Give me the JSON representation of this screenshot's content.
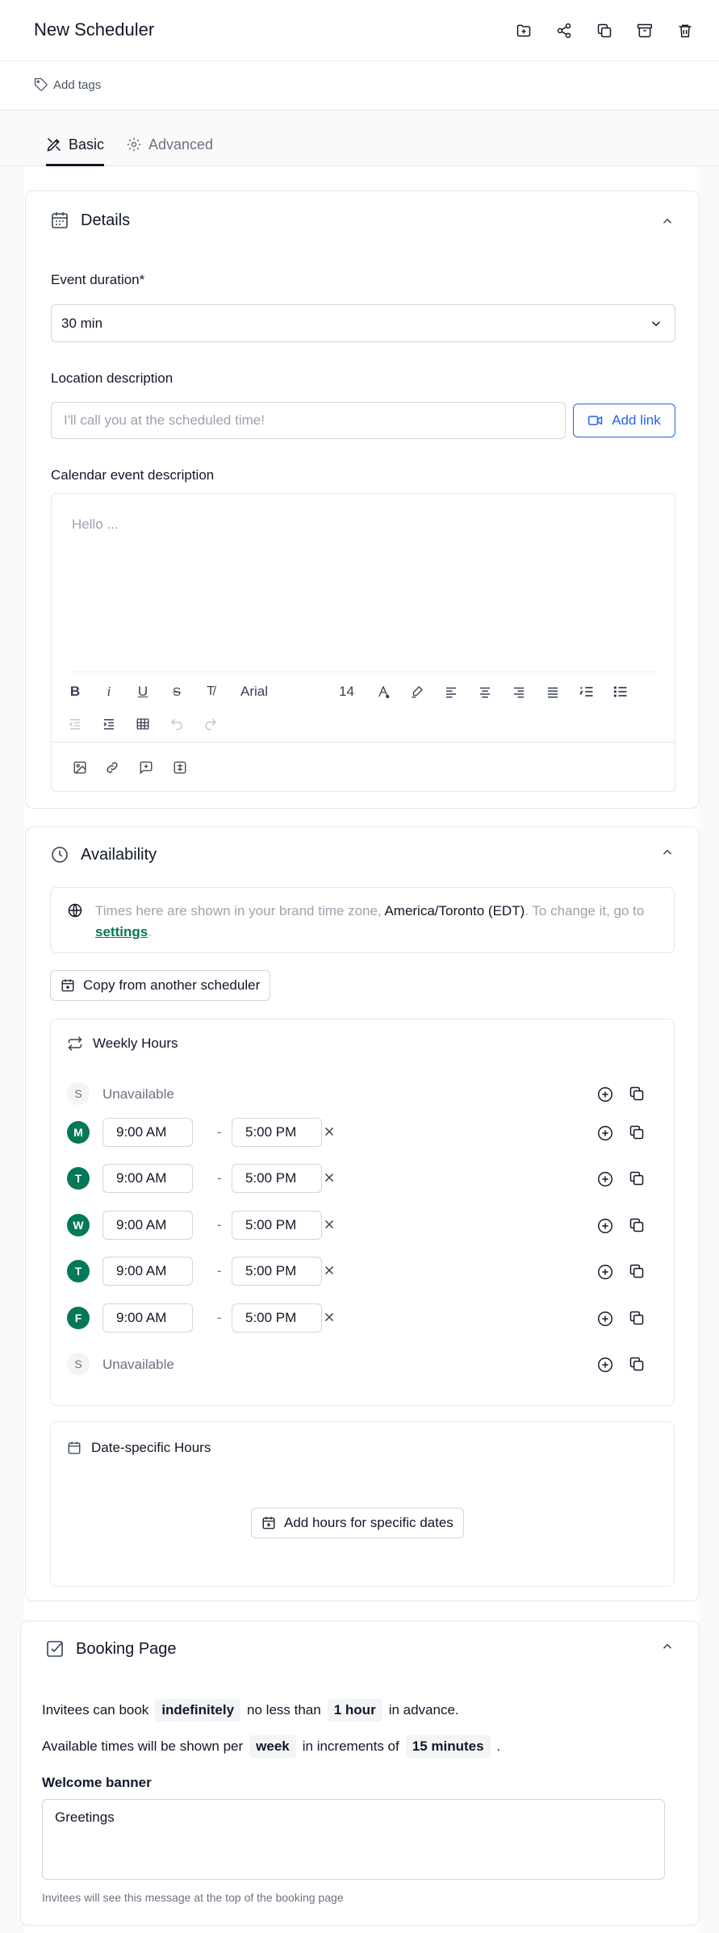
{
  "header": {
    "title": "New Scheduler",
    "actions": [
      "folder-add-icon",
      "share-icon",
      "duplicate-icon",
      "archive-icon",
      "trash-icon"
    ]
  },
  "tags": {
    "label": "Add tags"
  },
  "tabs": [
    {
      "label": "Basic",
      "active": true
    },
    {
      "label": "Advanced",
      "active": false
    }
  ],
  "details": {
    "title": "Details",
    "event_duration_label": "Event duration*",
    "event_duration_value": "30 min",
    "location_label": "Location description",
    "location_placeholder": "I'll call you at the scheduled time!",
    "add_link_label": "Add link",
    "calendar_label": "Calendar event description",
    "editor_placeholder": "Hello ...",
    "editor": {
      "font": "Arial",
      "size": "14"
    }
  },
  "availability": {
    "title": "Availability",
    "notice": {
      "prefix": "Times here are shown in your brand time zone, ",
      "timezone": "America/Toronto (EDT)",
      "middle": ". To change it, go to ",
      "link": "settings",
      "suffix": "."
    },
    "copy_button": "Copy from another scheduler",
    "weekly_title": "Weekly Hours",
    "days": [
      {
        "letter": "S",
        "available": false,
        "text": "Unavailable"
      },
      {
        "letter": "M",
        "available": true,
        "start": "9:00 AM",
        "end": "5:00 PM"
      },
      {
        "letter": "T",
        "available": true,
        "start": "9:00 AM",
        "end": "5:00 PM"
      },
      {
        "letter": "W",
        "available": true,
        "start": "9:00 AM",
        "end": "5:00 PM"
      },
      {
        "letter": "T",
        "available": true,
        "start": "9:00 AM",
        "end": "5:00 PM"
      },
      {
        "letter": "F",
        "available": true,
        "start": "9:00 AM",
        "end": "5:00 PM"
      },
      {
        "letter": "S",
        "available": false,
        "text": "Unavailable"
      }
    ],
    "date_specific_title": "Date-specific Hours",
    "add_hours_button": "Add hours for specific dates"
  },
  "booking": {
    "title": "Booking Page",
    "line1": {
      "a": "Invitees can book",
      "pill1": "indefinitely",
      "b": "no less than",
      "pill2": "1 hour",
      "c": "in advance."
    },
    "line2": {
      "a": "Available times will be shown per",
      "pill1": "week",
      "b": "in increments of",
      "pill2": "15 minutes",
      "c": "."
    },
    "welcome_label": "Welcome banner",
    "welcome_value": "Greetings",
    "hint": "Invitees will see this message at the top of the booking page"
  },
  "colors": {
    "accent": "#047857",
    "link": "#2563eb",
    "border": "#e5e7eb"
  }
}
